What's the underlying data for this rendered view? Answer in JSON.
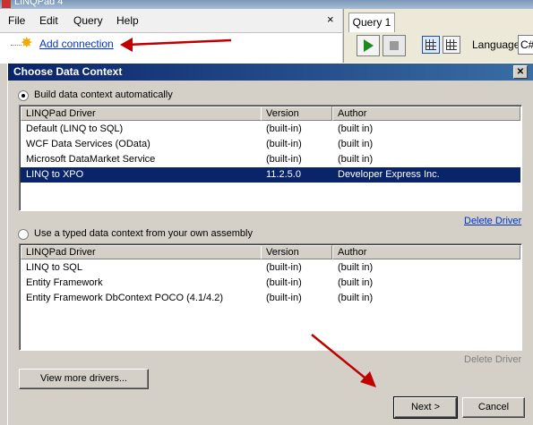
{
  "app": {
    "title": "LINQPad 4"
  },
  "menu": {
    "items": [
      "File",
      "Edit",
      "Query",
      "Help"
    ],
    "close": "×"
  },
  "connections": {
    "add_connection": "Add connection"
  },
  "query": {
    "tab": "Query 1",
    "language_label": "Language",
    "language_value": "C#"
  },
  "dialog": {
    "title": "Choose Data Context",
    "close": "✕",
    "section1": {
      "radio_label": "Build data context automatically",
      "selected": true,
      "columns": [
        "LINQPad Driver",
        "Version",
        "Author"
      ],
      "rows": [
        [
          "Default (LINQ to SQL)",
          "(built-in)",
          "(built in)"
        ],
        [
          "WCF Data Services (OData)",
          "(built-in)",
          "(built in)"
        ],
        [
          "Microsoft DataMarket Service",
          "(built-in)",
          "(built in)"
        ],
        [
          "LINQ to XPO",
          "11.2.5.0",
          "Developer Express Inc."
        ]
      ],
      "selected_row": 3,
      "delete_driver": "Delete Driver"
    },
    "section2": {
      "radio_label": "Use a typed data context from your own assembly",
      "selected": false,
      "columns": [
        "LINQPad Driver",
        "Version",
        "Author"
      ],
      "rows": [
        [
          "LINQ to SQL",
          "(built-in)",
          "(built in)"
        ],
        [
          "Entity Framework",
          "(built-in)",
          "(built in)"
        ],
        [
          "Entity Framework DbContext POCO (4.1/4.2)",
          "(built-in)",
          "(built in)"
        ]
      ],
      "delete_driver": "Delete Driver"
    },
    "buttons": {
      "view_more": "View more drivers...",
      "next": "Next >",
      "cancel": "Cancel"
    }
  },
  "colors": {
    "selection": "#0a246a",
    "title_bar": "#0a246a",
    "annotation_arrow": "#c00000",
    "link": "#0033cc"
  }
}
